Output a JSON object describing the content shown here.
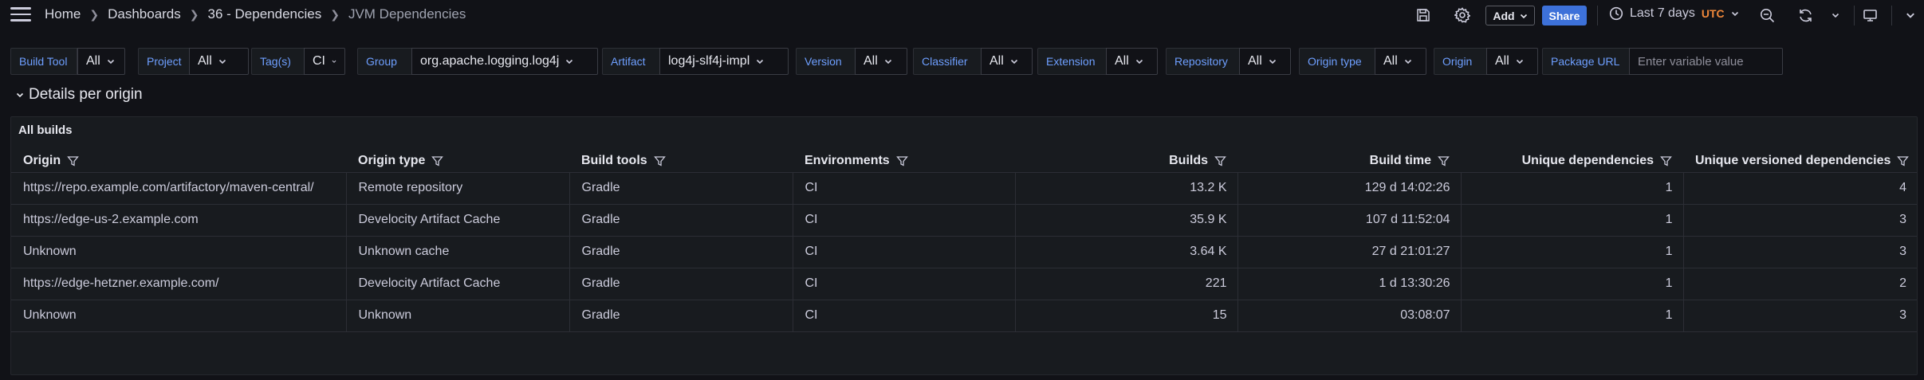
{
  "breadcrumb": {
    "home": "Home",
    "dashboards": "Dashboards",
    "folder": "36 - Dependencies",
    "current": "JVM Dependencies"
  },
  "toolbar": {
    "add_label": "Add",
    "share_label": "Share",
    "time_range": "Last 7 days",
    "timezone": "UTC",
    "icons": [
      "save-icon",
      "settings-icon",
      "clock-icon",
      "zoom-out-icon",
      "refresh-icon",
      "chevron-down-icon",
      "tv-mode-icon",
      "collapse-icon"
    ]
  },
  "variables": [
    {
      "label": "Build Tool",
      "value": "All"
    },
    {
      "label": "Project",
      "value": "All"
    },
    {
      "label": "Tag(s)",
      "value": "CI"
    },
    {
      "label": "Group",
      "value": "org.apache.logging.log4j"
    },
    {
      "label": "Artifact",
      "value": "log4j-slf4j-impl"
    },
    {
      "label": "Version",
      "value": "All"
    },
    {
      "label": "Classifier",
      "value": "All"
    },
    {
      "label": "Extension",
      "value": "All"
    },
    {
      "label": "Repository",
      "value": "All"
    },
    {
      "label": "Origin type",
      "value": "All"
    },
    {
      "label": "Origin",
      "value": "All"
    },
    {
      "label": "Package URL",
      "placeholder": "Enter variable value"
    }
  ],
  "row": {
    "title": "Details per origin"
  },
  "panel": {
    "title": "All builds",
    "columns": [
      "Origin",
      "Origin type",
      "Build tools",
      "Environments",
      "Builds",
      "Build time",
      "Unique dependencies",
      "Unique versioned dependencies"
    ],
    "rows": [
      [
        "https://repo.example.com/artifactory/maven-central/",
        "Remote repository",
        "Gradle",
        "CI",
        "13.2 K",
        "129 d 14:02:26",
        "1",
        "4"
      ],
      [
        "https://edge-us-2.example.com",
        "Develocity Artifact Cache",
        "Gradle",
        "CI",
        "35.9 K",
        "107 d 11:52:04",
        "1",
        "3"
      ],
      [
        "Unknown",
        "Unknown cache",
        "Gradle",
        "CI",
        "3.64 K",
        "27 d 21:01:27",
        "1",
        "3"
      ],
      [
        "https://edge-hetzner.example.com/",
        "Develocity Artifact Cache",
        "Gradle",
        "CI",
        "221",
        "1 d 13:30:26",
        "1",
        "2"
      ],
      [
        "Unknown",
        "Unknown",
        "Gradle",
        "CI",
        "15",
        "03:08:07",
        "1",
        "3"
      ]
    ]
  },
  "colors": {
    "background": "#111217",
    "panel": "#181b1f",
    "accent": "#3d71d9",
    "variable_label": "#6e9fff",
    "timezone": "#f0883a"
  }
}
